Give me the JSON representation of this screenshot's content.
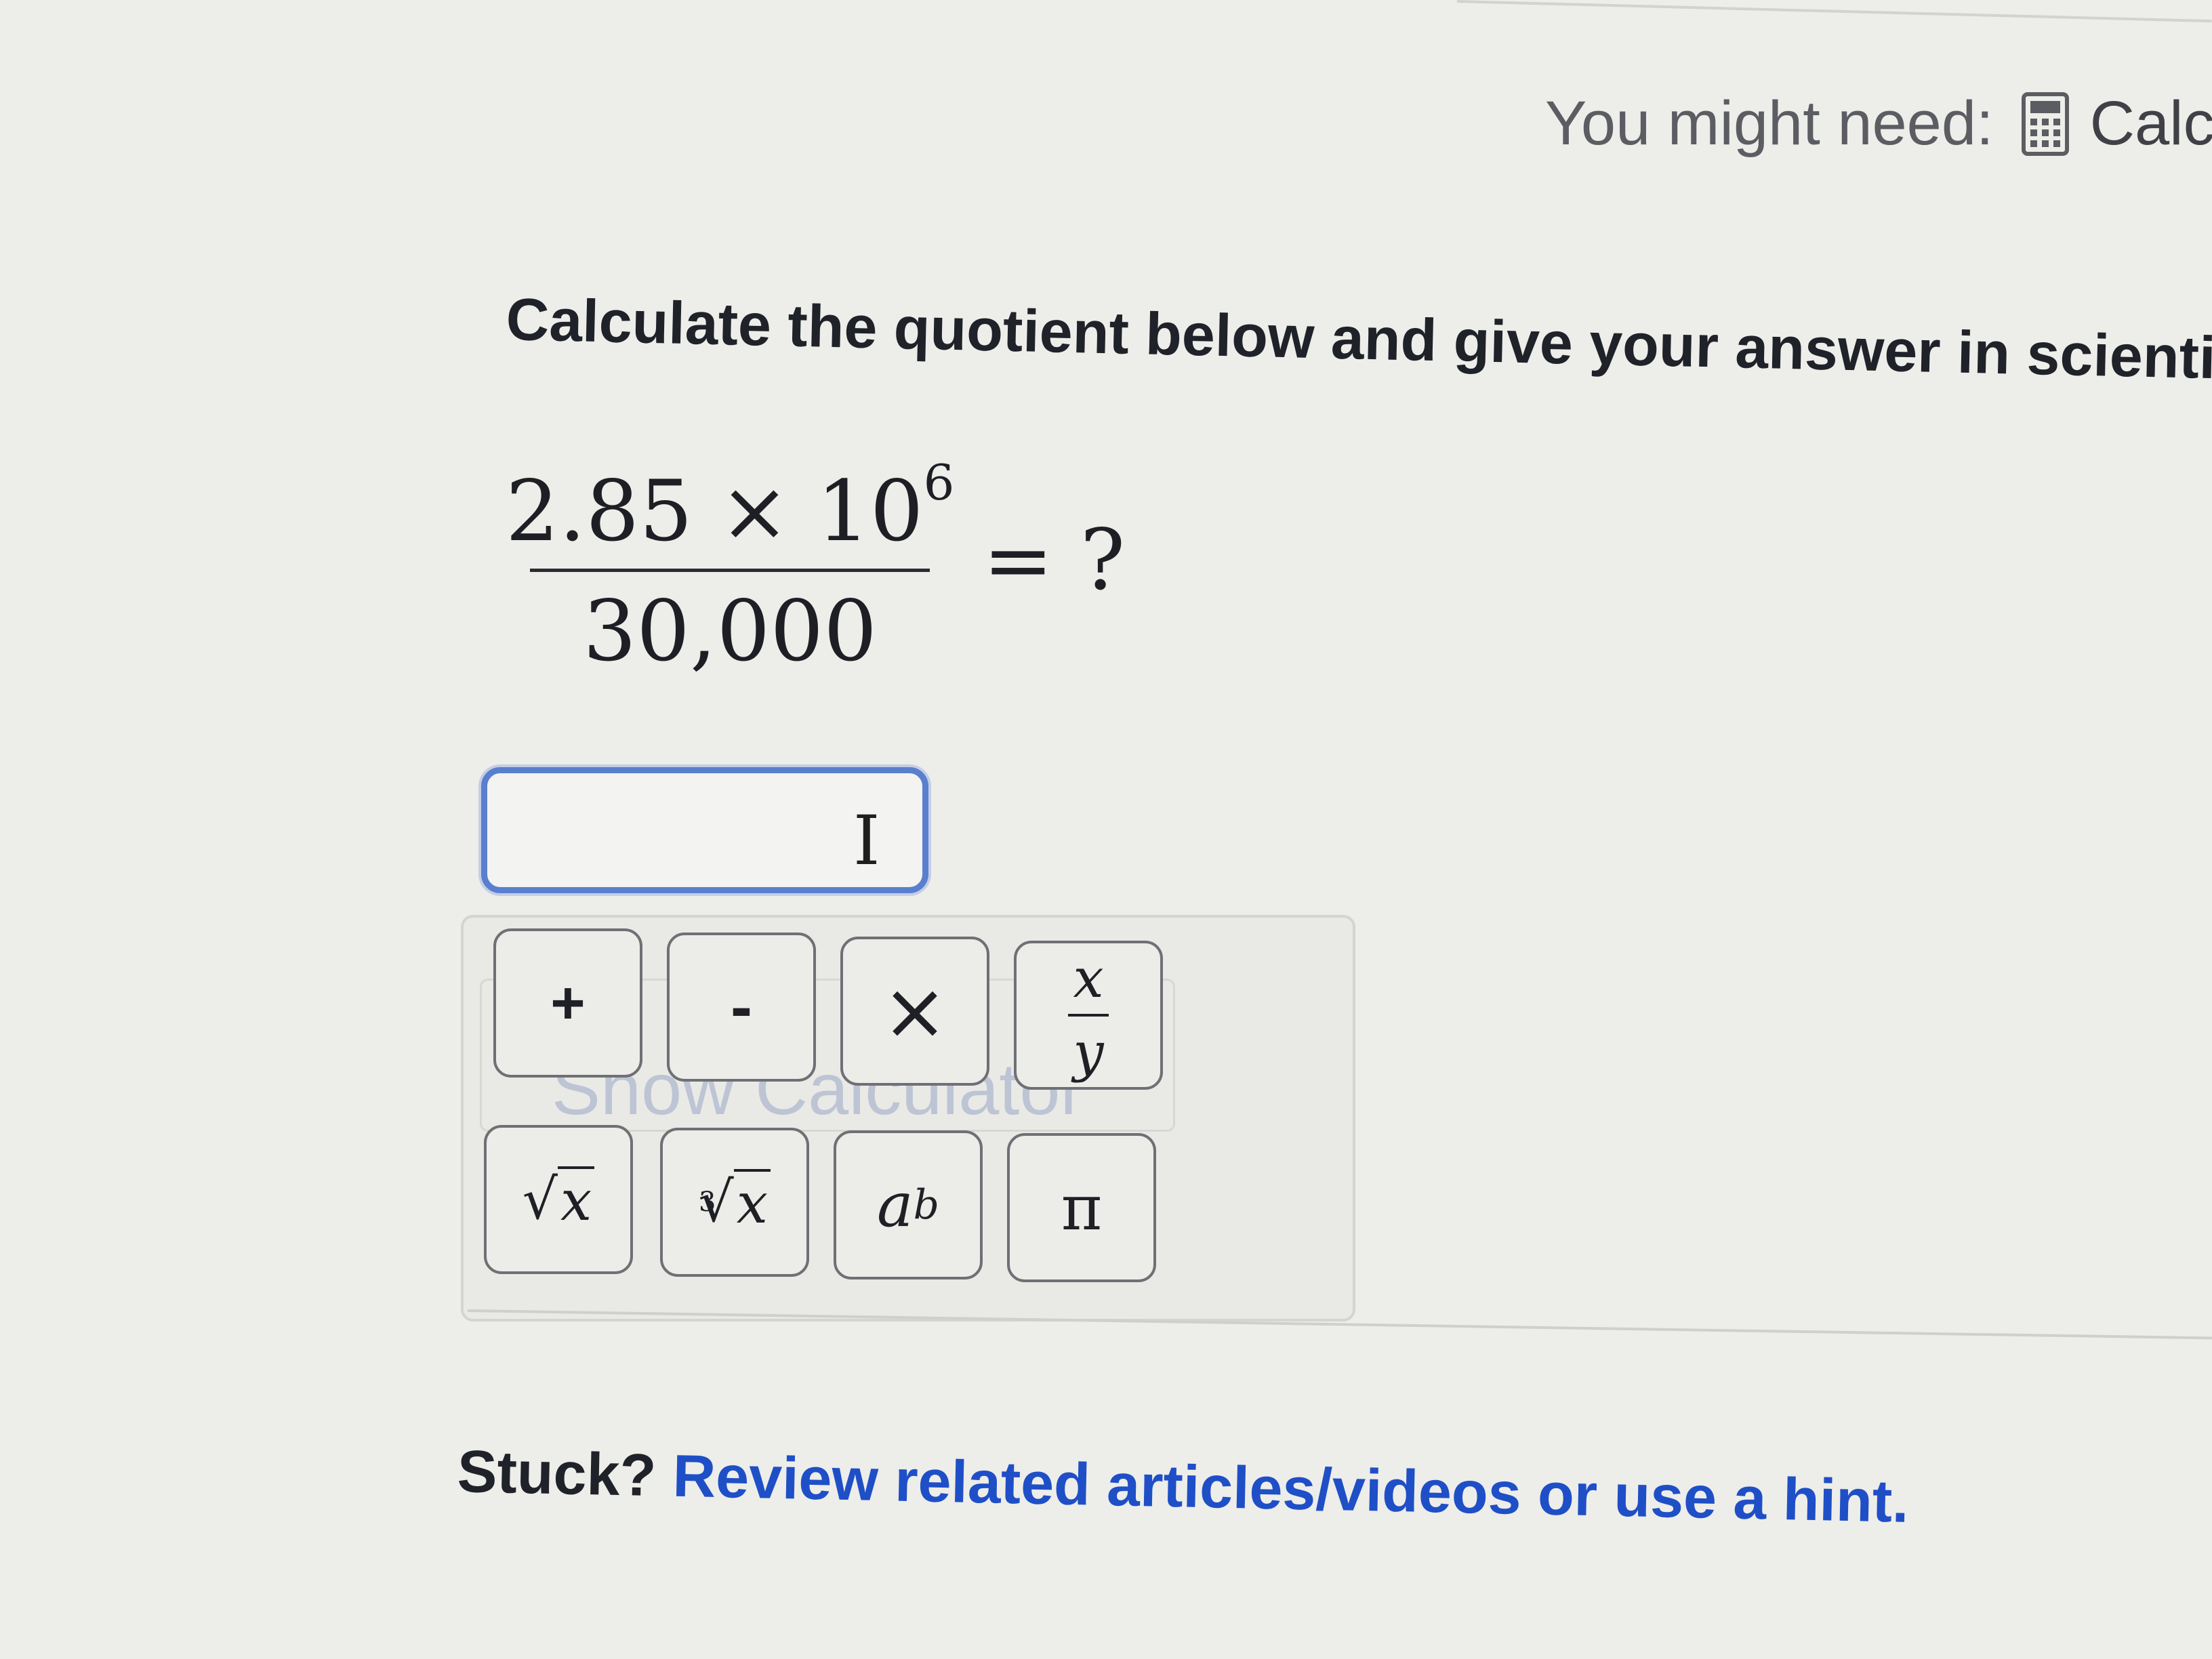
{
  "header": {
    "might_need_label": "You might need:",
    "calculator_link": "Calcu",
    "calculator_icon": "calculator-icon"
  },
  "question": {
    "prompt": "Calculate the quotient below and give your answer in scientific"
  },
  "expression": {
    "numerator_mantissa": "2.85 × 10",
    "numerator_exponent": "6",
    "denominator": "30,000",
    "equals": "= ?"
  },
  "answer": {
    "value": "",
    "cursor_icon": "ibeam-cursor-icon"
  },
  "keypad": {
    "ghost_text": "Show Calculator",
    "keys": {
      "plus": "+",
      "minus": "-",
      "times": "×",
      "frac_top": "x",
      "frac_bottom": "y",
      "sqrt_symbol": "√",
      "sqrt_var": "x",
      "cbrt_index": "3",
      "cbrt_symbol": "√",
      "cbrt_var": "x",
      "pow_base": "a",
      "pow_exp": "b",
      "pi": "π"
    }
  },
  "footer": {
    "stuck_label": "Stuck?",
    "hint_link": "Review related articles/videos or use a hint."
  },
  "colors": {
    "background": "#ededea",
    "input_focus_border": "#5a7fcf",
    "link": "#1f4fc7"
  }
}
